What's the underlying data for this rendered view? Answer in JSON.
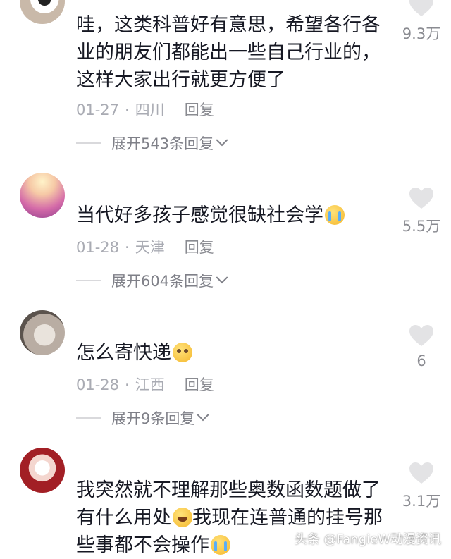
{
  "comments": [
    {
      "text": "哇，这类科普好有意思，希望各行各业的朋友们都能出一些自己行业的，这样大家出行就更方便了",
      "date": "01-27",
      "location": "四川",
      "reply_label": "回复",
      "expand_label": "展开543条回复",
      "likes": "9.3万"
    },
    {
      "text": "当代好多孩子感觉很缺社会学",
      "emoji": "loudly-crying-face-icon",
      "date": "01-28",
      "location": "天津",
      "reply_label": "回复",
      "expand_label": "展开604条回复",
      "likes": "5.5万"
    },
    {
      "text": "怎么寄快递",
      "emoji": "pleading-face-icon",
      "date": "01-28",
      "location": "江西",
      "reply_label": "回复",
      "expand_label": "展开9条回复",
      "likes": "6"
    },
    {
      "text_part1": "我突然就不理解那些奥数函数题做了有什么用处",
      "emoji1": "grinning-sweat-face-icon",
      "text_part2": "我现在连普通的挂号那些事都不会操作",
      "emoji2": "loudly-crying-face-icon",
      "likes": "3.1万"
    }
  ],
  "watermark": "头条 @FangieW动漫资讯",
  "colors": {
    "text": "#161823",
    "meta": "#a9abb3",
    "heart": "#e3e3e5"
  }
}
